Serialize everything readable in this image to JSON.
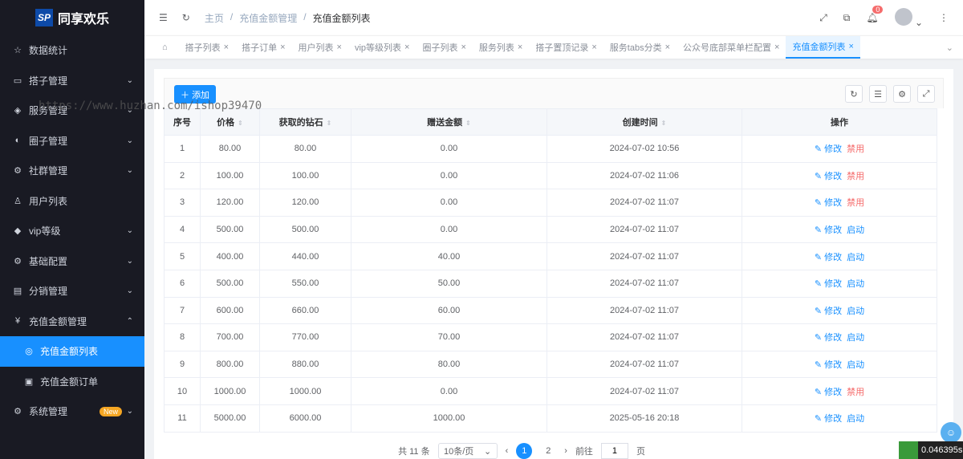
{
  "app": {
    "title": "同享欢乐",
    "logo_text": "SP"
  },
  "sidebar": {
    "items": [
      {
        "label": "数据统计",
        "icon": "☆",
        "chev": ""
      },
      {
        "label": "搭子管理",
        "icon": "▭",
        "chev": "⌄"
      },
      {
        "label": "服务管理",
        "icon": "◈",
        "chev": "⌄"
      },
      {
        "label": "圈子管理",
        "icon": "◐",
        "chev": "⌄"
      },
      {
        "label": "社群管理",
        "icon": "⚙",
        "chev": "⌄"
      },
      {
        "label": "用户列表",
        "icon": "♙",
        "chev": ""
      },
      {
        "label": "vip等级",
        "icon": "◆",
        "chev": "⌄"
      },
      {
        "label": "基础配置",
        "icon": "⚙",
        "chev": "⌄"
      },
      {
        "label": "分销管理",
        "icon": "▤",
        "chev": "⌄"
      },
      {
        "label": "充值金额管理",
        "icon": "¥",
        "chev": "⌃"
      },
      {
        "label": "充值金额列表",
        "icon": "◎",
        "chev": ""
      },
      {
        "label": "充值金额订单",
        "icon": "▣",
        "chev": ""
      },
      {
        "label": "系统管理",
        "icon": "⚙",
        "chev": "⌄",
        "badge": "New"
      }
    ]
  },
  "header": {
    "breadcrumb": [
      "主页",
      "充值金额管理",
      "充值金额列表"
    ],
    "notifications": "0"
  },
  "tabs": [
    "搭子列表",
    "搭子订单",
    "用户列表",
    "vip等级列表",
    "圈子列表",
    "服务列表",
    "搭子置顶记录",
    "服务tabs分类",
    "公众号底部菜单栏配置",
    "充值金额列表"
  ],
  "toolbar": {
    "add_label": "添加"
  },
  "table": {
    "headers": [
      "序号",
      "价格",
      "获取的钻石",
      "赠送金额",
      "创建时间",
      "操作"
    ],
    "edit_label": "修改",
    "rows": [
      [
        "1",
        "80.00",
        "80.00",
        "0.00",
        "2024-07-02 10:56",
        "禁用"
      ],
      [
        "2",
        "100.00",
        "100.00",
        "0.00",
        "2024-07-02 11:06",
        "禁用"
      ],
      [
        "3",
        "120.00",
        "120.00",
        "0.00",
        "2024-07-02 11:07",
        "禁用"
      ],
      [
        "4",
        "500.00",
        "500.00",
        "0.00",
        "2024-07-02 11:07",
        "启动"
      ],
      [
        "5",
        "400.00",
        "440.00",
        "40.00",
        "2024-07-02 11:07",
        "启动"
      ],
      [
        "6",
        "500.00",
        "550.00",
        "50.00",
        "2024-07-02 11:07",
        "启动"
      ],
      [
        "7",
        "600.00",
        "660.00",
        "60.00",
        "2024-07-02 11:07",
        "启动"
      ],
      [
        "8",
        "700.00",
        "770.00",
        "70.00",
        "2024-07-02 11:07",
        "启动"
      ],
      [
        "9",
        "800.00",
        "880.00",
        "80.00",
        "2024-07-02 11:07",
        "启动"
      ],
      [
        "10",
        "1000.00",
        "1000.00",
        "0.00",
        "2024-07-02 11:07",
        "禁用"
      ],
      [
        "11",
        "5000.00",
        "6000.00",
        "1000.00",
        "2025-05-16 20:18",
        "启动"
      ]
    ]
  },
  "pagination": {
    "total": "共 11 条",
    "page_size": "10条/页",
    "pages": [
      "1",
      "2"
    ],
    "goto_label": "前往",
    "goto_value": "1",
    "page_suffix": "页"
  },
  "watermark": "https://www.huzhan.com/ishop39470",
  "timer": "0.046395s"
}
